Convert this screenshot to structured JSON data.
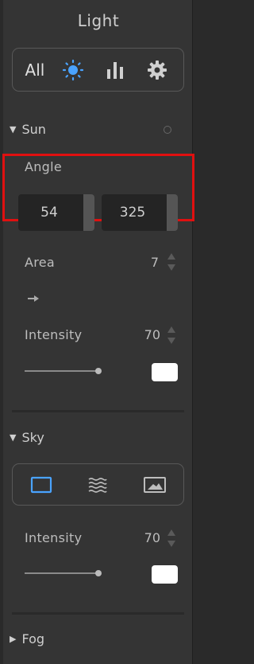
{
  "panel": {
    "title": "Light"
  },
  "topbar": {
    "all_label": "All",
    "icons": [
      "sun-icon",
      "bar-chart-icon",
      "gear-icon"
    ],
    "active_icon": "sun-icon",
    "accent_color": "#4aa3ff"
  },
  "sun": {
    "header": "Sun",
    "angle_label": "Angle",
    "angle_values": [
      "54",
      "325"
    ],
    "area_label": "Area",
    "area_value": "7",
    "intensity_label": "Intensity",
    "intensity_value": "70",
    "intensity_color": "#ffffff"
  },
  "sky": {
    "header": "Sky",
    "mode_icons": [
      "rectangle-icon",
      "waves-icon",
      "image-icon"
    ],
    "active_mode": "rectangle-icon",
    "intensity_label": "Intensity",
    "intensity_value": "70",
    "intensity_color": "#ffffff"
  },
  "fog": {
    "header": "Fog"
  }
}
